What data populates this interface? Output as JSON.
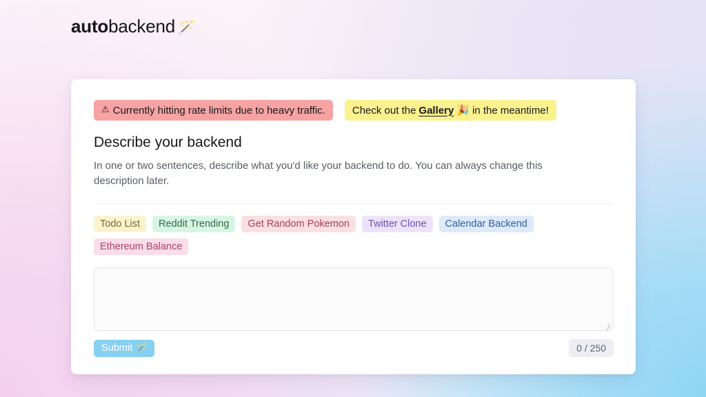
{
  "brand": {
    "word_bold": "auto",
    "word_light": "backend",
    "wand_icon": "🪄"
  },
  "banners": {
    "warning": {
      "icon": "⚠",
      "icon_name": "warning-triangle-icon",
      "text": "Currently hitting rate limits due to heavy traffic.",
      "background": "#f7a3a3"
    },
    "info": {
      "prefix": "Check out the",
      "link_label": "Gallery",
      "party_icon": "🎉",
      "suffix": "in the meantime!",
      "background": "#fbf18e"
    }
  },
  "form": {
    "title": "Describe your backend",
    "description": "In one or two sentences, describe what you'd like your backend to do. You can always change this description later.",
    "textarea_value": "",
    "textarea_placeholder": "",
    "submit_label": "Submit",
    "submit_icon": "🪄",
    "char_counter": "0 / 250",
    "max_chars": 250,
    "current_chars": 0
  },
  "chips": [
    {
      "label": "Todo List",
      "bg": "#fbf3cf",
      "fg": "#7a6a2b"
    },
    {
      "label": "Reddit Trending",
      "bg": "#d8f5e3",
      "fg": "#2f6b4b"
    },
    {
      "label": "Get Random Pokemon",
      "bg": "#fbdfe3",
      "fg": "#a34356"
    },
    {
      "label": "Twitter Clone",
      "bg": "#ece3fb",
      "fg": "#6b4fbb"
    },
    {
      "label": "Calendar Backend",
      "bg": "#ddeafb",
      "fg": "#31609c"
    },
    {
      "label": "Ethereum Balance",
      "bg": "#fbdde8",
      "fg": "#a8436b"
    }
  ]
}
